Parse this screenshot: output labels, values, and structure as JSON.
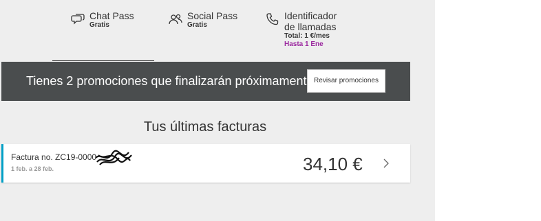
{
  "benefits": [
    {
      "title": "Chat Pass",
      "sub": "Gratis",
      "icon": "chat-icon"
    },
    {
      "title": "Social Pass",
      "sub": "Gratis",
      "icon": "people-icon"
    },
    {
      "title": "Identificador de llamadas",
      "title_line1": "Identificador",
      "title_line2": "de llamadas",
      "sub": "Total: 1 €/mes",
      "promo": "Hasta 1 Ene",
      "icon": "phone-icon"
    }
  ],
  "promo_banner": {
    "text": "Tienes 2 promociones que finalizarán próximamente",
    "button_label": "Revisar promociones"
  },
  "invoices": {
    "title": "Tus últimas facturas",
    "items": [
      {
        "label": "Factura no. ZC19-0000",
        "dates": "1 feb. a 28 feb.",
        "amount": "34,10  €"
      }
    ]
  },
  "colors": {
    "banner_bg": "#4a4d4e",
    "accent_blue": "#00a0c6",
    "promo_purple": "#9c2aa0",
    "page_bg": "#eeeeee"
  }
}
